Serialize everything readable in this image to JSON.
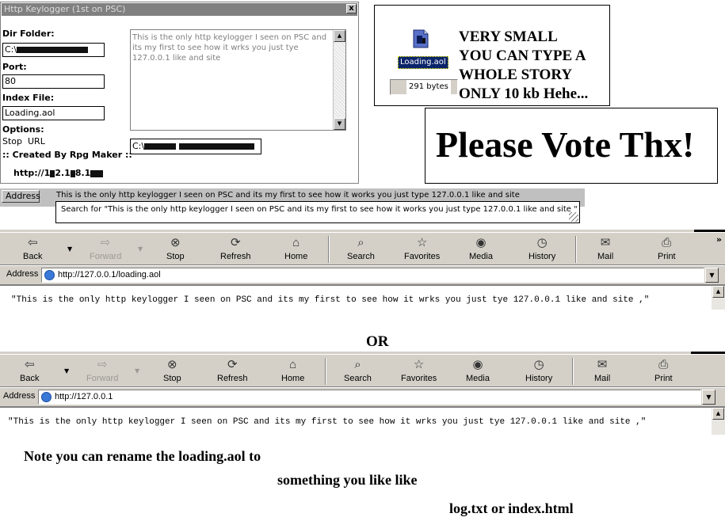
{
  "keylogger": {
    "title": "Http Keylogger (1st on PSC)",
    "close_label": "x",
    "dir_folder_label": "Dir Folder:",
    "dir_folder_value": "C:\\",
    "port_label": "Port:",
    "port_value": "80",
    "index_file_label": "Index File:",
    "index_file_value": "Loading.aol",
    "options_label": "Options:",
    "option_stop": "Stop",
    "option_url": "URL",
    "credit": ":: Created By Rpg Maker ::",
    "textarea_text": "This is the only http keylogger I seen on PSC and its my first to see how it wrks you just tye 127.0.0.1 like and site",
    "path_value": "C:\\",
    "url_prefix": "http://1",
    "url_mid1": "2.1",
    "url_mid2": "8.1"
  },
  "file_panel": {
    "file_name": "Loading.aol",
    "file_size": "291 bytes",
    "description": [
      "VERY SMALL",
      "YOU CAN TYPE A",
      "WHOLE STORY",
      "ONLY 10 kb Hehe..."
    ]
  },
  "vote": {
    "text": "Please Vote Thx!"
  },
  "address_strip": {
    "label": "Address",
    "text": "This is the only http keylogger I seen on PSC and its my first to see how it works you just type 127.0.0.1 like and site",
    "suggestion": "Search for \"This is the only http keylogger I seen on PSC and its my first to see how it works you just type 127.0.0.1 like and site \""
  },
  "toolbar_labels": {
    "back": "Back",
    "forward": "Forward",
    "stop": "Stop",
    "refresh": "Refresh",
    "home": "Home",
    "search": "Search",
    "favorites": "Favorites",
    "media": "Media",
    "history": "History",
    "mail": "Mail",
    "print": "Print"
  },
  "browser1": {
    "address_label": "Address",
    "url": "http://127.0.0.1/loading.aol",
    "content": "\"This is the only http keylogger I seen on PSC and its my first to see how it wrks you just tye 127.0.0.1 like and site ,\""
  },
  "or_text": "OR",
  "browser2": {
    "address_label": "Address",
    "url": "http://127.0.0.1",
    "content": "\"This is the only http keylogger I seen on PSC and its my first to see how it wrks you just tye 127.0.0.1 like and site ,\""
  },
  "notes": {
    "line1": "Note you can rename the loading.aol to",
    "line2": "something you like like",
    "line3": "log.txt or index.html"
  }
}
